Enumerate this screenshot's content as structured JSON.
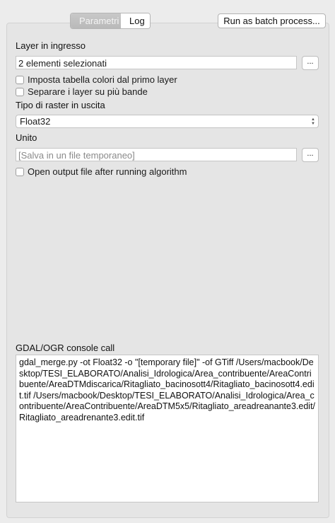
{
  "tabs": [
    {
      "label": "Parametri",
      "active": true
    },
    {
      "label": "Log",
      "active": false
    }
  ],
  "batch_button": "Run as batch process...",
  "input_layer": {
    "label": "Layer in ingresso",
    "value": "2 elementi selezionati",
    "browse": "..."
  },
  "checkboxes": [
    {
      "label": "Imposta tabella colori dal primo layer",
      "checked": false
    },
    {
      "label": "Separare i layer su più bande",
      "checked": false
    }
  ],
  "raster_type": {
    "label": "Tipo di raster in uscita",
    "value": "Float32"
  },
  "output": {
    "label": "Unito",
    "placeholder": "[Salva in un file temporaneo]",
    "browse": "..."
  },
  "open_output": {
    "label": "Open output file after running algorithm",
    "checked": false
  },
  "console": {
    "label": "GDAL/OGR console call",
    "text": "gdal_merge.py -ot Float32 -o \"[temporary file]\" -of GTiff /Users/macbook/Desktop/TESI_ELABORATO/Analisi_Idrologica/Area_contribuente/AreaContribuente/AreaDTMdiscarica/Ritagliato_bacinosott4/Ritagliato_bacinosott4.edit.tif /Users/macbook/Desktop/TESI_ELABORATO/Analisi_Idrologica/Area_contribuente/AreaContribuente/AreaDTM5x5/Ritagliato_areadreanante3.edit/Ritagliato_areadrenante3.edit.tif"
  }
}
